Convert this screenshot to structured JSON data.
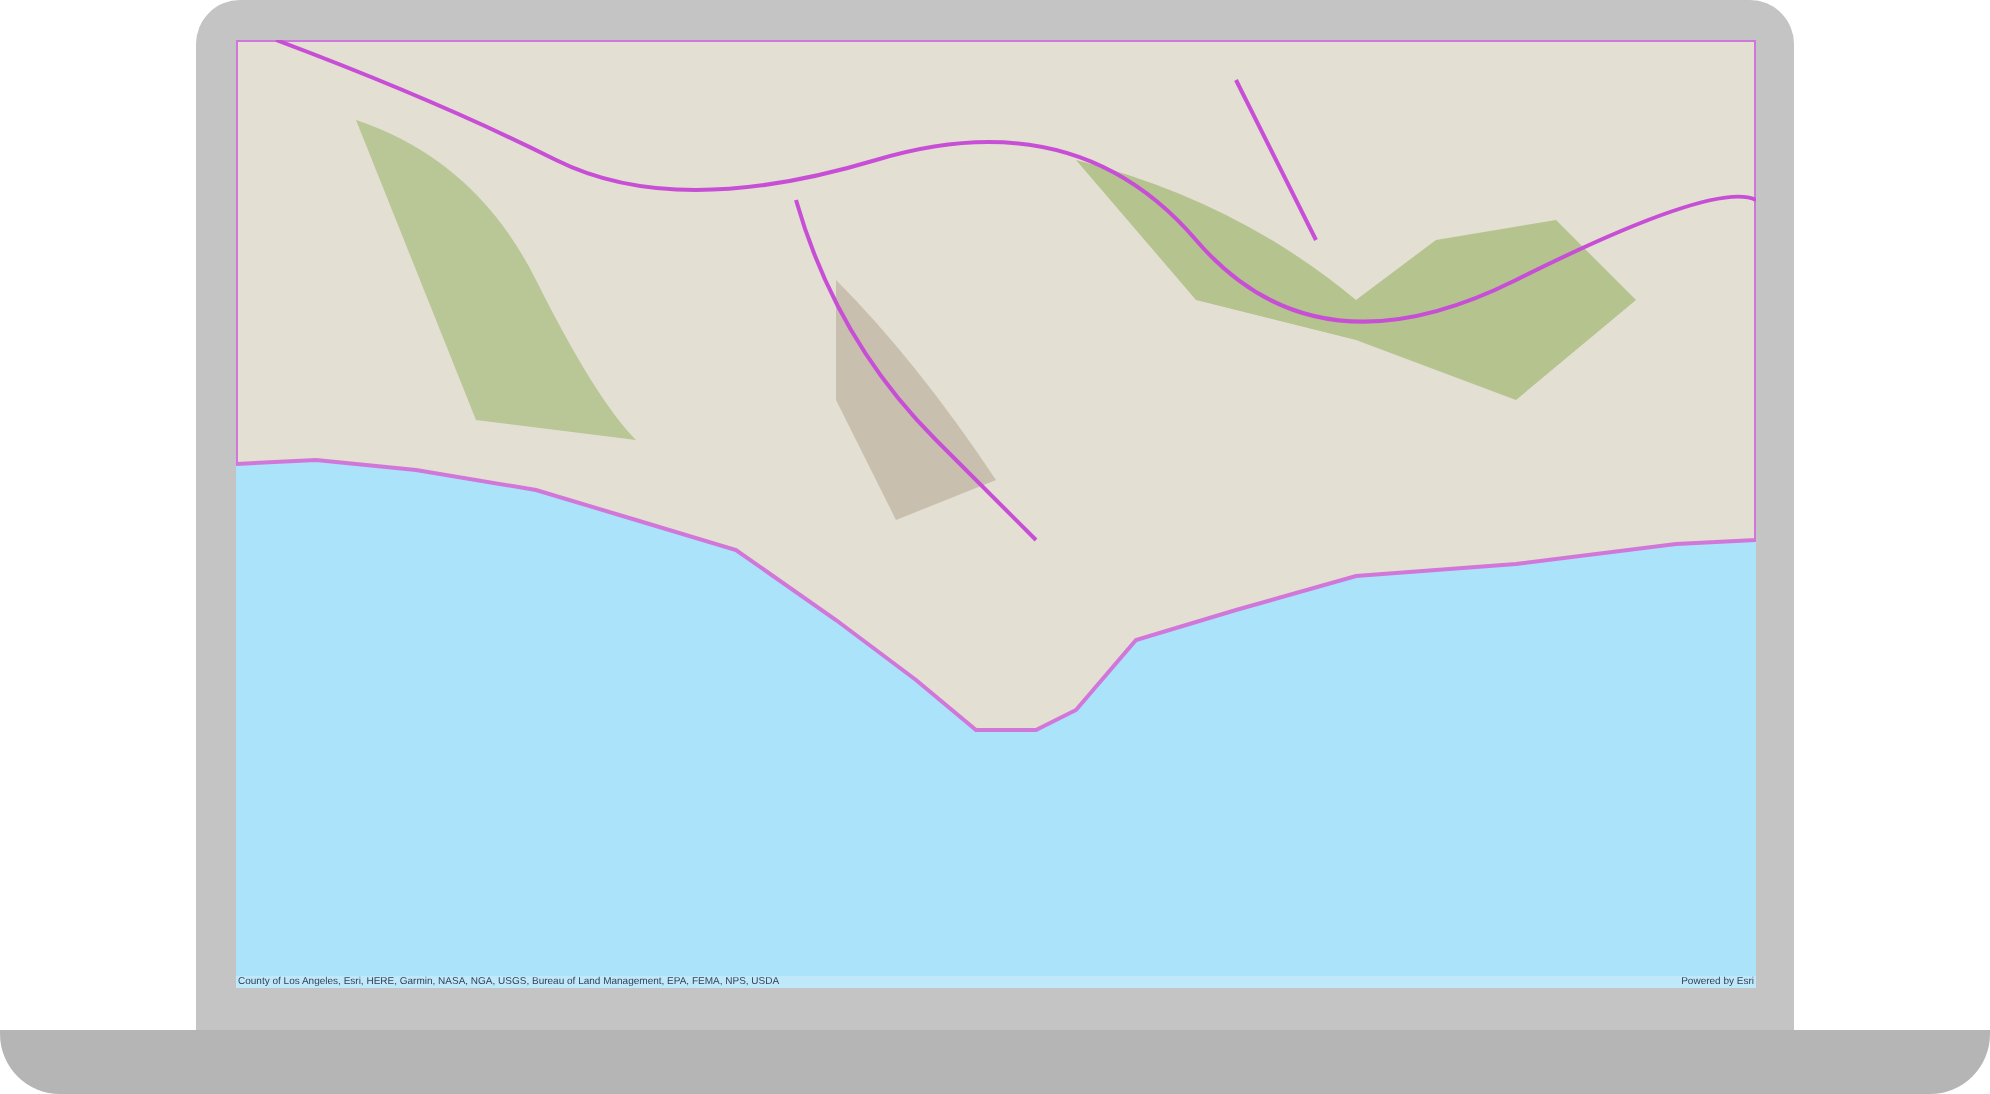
{
  "map": {
    "attribution": "County of Los Angeles, Esri, HERE, Garmin, NASA, NGA, USGS, Bureau of Land Management, EPA, FEMA, NPS, USDA",
    "powered_by": "Powered by Esri"
  }
}
